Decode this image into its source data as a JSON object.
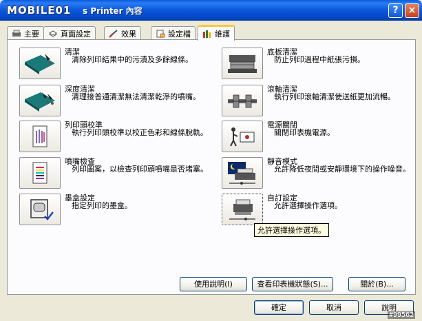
{
  "titlebar": {
    "logo_text": "MOBILE01",
    "title": "s Printer 內容",
    "help_glyph": "?",
    "close_glyph": "×"
  },
  "tabs": [
    {
      "label": "主要",
      "icon": "printer-icon"
    },
    {
      "label": "頁面設定",
      "icon": "page-stack-icon"
    },
    {
      "label": "效果",
      "icon": "brush-icon"
    },
    {
      "label": "設定檔",
      "icon": "profile-icon"
    },
    {
      "label": "維護",
      "icon": "toolbox-icon",
      "active": true
    }
  ],
  "maintenance": {
    "left": [
      {
        "name": "清潔",
        "desc": "清除列印結果中的污漬及多餘線條。",
        "icon": "cleaning-icon"
      },
      {
        "name": "深度清潔",
        "desc": "清理接普通清潔無法清潔乾淨的噴嘴。",
        "icon": "deep-cleaning-icon"
      },
      {
        "name": "列印頭校準",
        "desc": "執行列印頭校準以校正色彩和線條脫軌。",
        "icon": "head-alignment-icon"
      },
      {
        "name": "噴嘴檢查",
        "desc": "列印圖案，以檢查列印頭噴嘴是否堵塞。",
        "icon": "nozzle-check-icon"
      },
      {
        "name": "墨盒設定",
        "desc": "指定列印的墨盒。",
        "icon": "ink-cartridge-icon"
      }
    ],
    "right": [
      {
        "name": "底板清潔",
        "desc": "防止列印過程中紙張污損。",
        "icon": "bottom-plate-icon"
      },
      {
        "name": "滾軸清潔",
        "desc": "執行列印滾軸清潔使送紙更加流暢。",
        "icon": "roller-icon"
      },
      {
        "name": "電源關閉",
        "desc": "關閉印表機電源。",
        "icon": "power-off-icon"
      },
      {
        "name": "靜音模式",
        "desc": "允許降低夜間或安靜環境下的操作噪音。",
        "icon": "quiet-mode-icon"
      },
      {
        "name": "自訂設定",
        "desc": "允許選擇操作選項。",
        "icon": "custom-settings-icon"
      }
    ]
  },
  "tooltip": "允許選擇操作選項。",
  "panel_buttons": {
    "help": "使用說明(I)",
    "status": "查看印表機狀態(S)...",
    "about": "關於(B)..."
  },
  "dialog_buttons": {
    "ok": "確定",
    "cancel": "取消",
    "help": "說明"
  },
  "watermark": "#99562"
}
